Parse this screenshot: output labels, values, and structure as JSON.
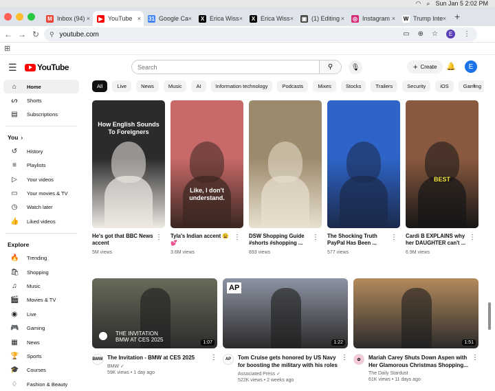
{
  "system": {
    "clock": "Sun Jan 5  2:02 PM"
  },
  "tabs": [
    {
      "label": "Inbox (94)",
      "icon": "gmail-icon",
      "color": "#ea4335",
      "glyph": "M"
    },
    {
      "label": "YouTube",
      "icon": "youtube-icon",
      "color": "#ff0000",
      "glyph": "▶",
      "active": true
    },
    {
      "label": "Google Ca",
      "icon": "calendar-icon",
      "color": "#4285f4",
      "glyph": "31"
    },
    {
      "label": "Erica Wiss",
      "icon": "x-icon",
      "color": "#000000",
      "glyph": "X"
    },
    {
      "label": "Erica Wiss",
      "icon": "x-icon",
      "color": "#000000",
      "glyph": "X"
    },
    {
      "label": "(1) Editing",
      "icon": "editing-icon",
      "color": "#444444",
      "glyph": "▣"
    },
    {
      "label": "Instagram",
      "icon": "instagram-icon",
      "color": "#d62976",
      "glyph": "◎"
    },
    {
      "label": "Trump Inte",
      "icon": "wikipedia-icon",
      "color": "#ffffff",
      "glyph": "W"
    }
  ],
  "address": {
    "url": "youtube.com",
    "profile": "E"
  },
  "header": {
    "logo": "YouTube",
    "search_placeholder": "Search",
    "create_label": "Create",
    "avatar": "E"
  },
  "sidebar": {
    "main": [
      {
        "label": "Home",
        "icon": "home-icon",
        "glyph": "⌂",
        "active": true
      },
      {
        "label": "Shorts",
        "icon": "shorts-icon",
        "glyph": "ᔕ"
      },
      {
        "label": "Subscriptions",
        "icon": "subscriptions-icon",
        "glyph": "▤"
      }
    ],
    "you_heading": "You",
    "you": [
      {
        "label": "History",
        "icon": "history-icon",
        "glyph": "↺"
      },
      {
        "label": "Playlists",
        "icon": "playlists-icon",
        "glyph": "≡"
      },
      {
        "label": "Your videos",
        "icon": "your-videos-icon",
        "glyph": "▷"
      },
      {
        "label": "Your movies & TV",
        "icon": "movies-icon",
        "glyph": "▭"
      },
      {
        "label": "Watch later",
        "icon": "watch-later-icon",
        "glyph": "◷"
      },
      {
        "label": "Liked videos",
        "icon": "liked-icon",
        "glyph": "👍"
      }
    ],
    "explore_heading": "Explore",
    "explore": [
      {
        "label": "Trending",
        "icon": "trending-icon",
        "glyph": "🔥"
      },
      {
        "label": "Shopping",
        "icon": "shopping-icon",
        "glyph": "🛍"
      },
      {
        "label": "Music",
        "icon": "music-icon",
        "glyph": "♫"
      },
      {
        "label": "Movies & TV",
        "icon": "movies-tv-icon",
        "glyph": "🎬"
      },
      {
        "label": "Live",
        "icon": "live-icon",
        "glyph": "◉"
      },
      {
        "label": "Gaming",
        "icon": "gaming-icon",
        "glyph": "🎮"
      },
      {
        "label": "News",
        "icon": "news-icon",
        "glyph": "▦"
      },
      {
        "label": "Sports",
        "icon": "sports-icon",
        "glyph": "🏆"
      },
      {
        "label": "Courses",
        "icon": "courses-icon",
        "glyph": "🎓"
      },
      {
        "label": "Fashion & Beauty",
        "icon": "fashion-icon",
        "glyph": "♢"
      }
    ]
  },
  "chips": [
    "All",
    "Live",
    "News",
    "Music",
    "AI",
    "Information technology",
    "Podcasts",
    "Mixes",
    "Stocks",
    "Trailers",
    "Security",
    "iOS",
    "Gaming"
  ],
  "shorts": [
    {
      "title": "He's got that BBC News accent",
      "views": "5M views",
      "overlay": "How English Sounds To Foreigners",
      "bg": "#2b2b2b",
      "accent": "#efeae4"
    },
    {
      "title": "Tyla's Indian accent 😩💕",
      "views": "3.6M views",
      "overlay": "Like, I don't understand.",
      "bg": "#c86a6a",
      "accent": "#3a2620"
    },
    {
      "title": "DSW Shopping Guide #shorts #shopping ...",
      "views": "693 views",
      "overlay": "",
      "bg": "#9c8a6c",
      "accent": "#e8e0d0"
    },
    {
      "title": "The Shocking Truth PayPal Has Been ...",
      "views": "577 views",
      "overlay": "",
      "bg": "#2e64c8",
      "accent": "#1b2a4a"
    },
    {
      "title": "Cardi B EXPLAINS why her DAUGHTER can't ...",
      "views": "6.9M views",
      "overlay": "BEST",
      "bg": "#8a5a40",
      "accent": "#161616"
    }
  ],
  "videos": [
    {
      "title": "The Invitation - BMW at CES 2025",
      "channel": "BMW ✓",
      "stats": "59K views • 1 day ago",
      "duration": "1:07",
      "overlay": "THE INVITATION BMW AT CES 2025",
      "bg": "#6a6a5a",
      "avatar_bg": "#ffffff",
      "avatar": "BMW"
    },
    {
      "title": "Tom Cruise gets honored by US Navy for boosting the military with his roles",
      "channel": "Associated Press ✓",
      "stats": "522K views • 2 weeks ago",
      "duration": "1:22",
      "overlay": "AP",
      "bg": "#8c93a3",
      "avatar_bg": "#ffffff",
      "avatar": "AP"
    },
    {
      "title": "Mariah Carey Shuts Down Aspen with Her Glamorous Christmas Shopping...",
      "channel": "The Daily Stardust",
      "stats": "61K views • 11 days ago",
      "duration": "1:51",
      "overlay": "",
      "bg": "#b48a5c",
      "avatar_bg": "#f6c7d8",
      "avatar": "✿"
    }
  ]
}
